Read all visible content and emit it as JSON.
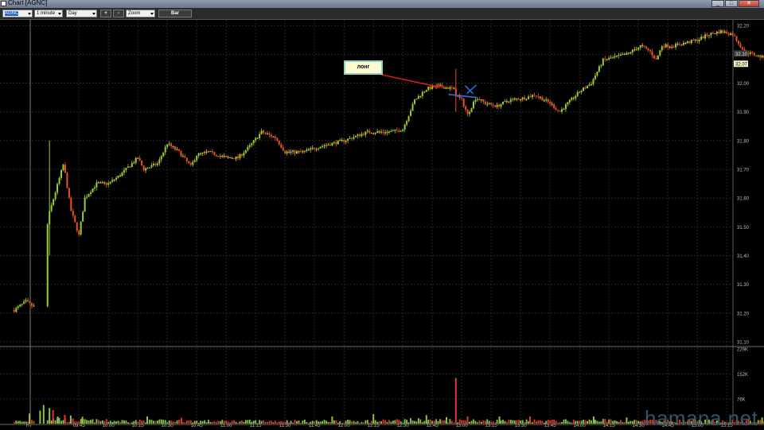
{
  "window": {
    "title": "Chart [AGNC]",
    "btn_min": "_",
    "btn_max": "□",
    "btn_close": "✕"
  },
  "toolbar": {
    "symbol": "AGNC",
    "interval": "1 minute",
    "range": "Day",
    "zoom_in": "+",
    "zoom_out": "-",
    "zoom": "Zoom",
    "bar": "Bar"
  },
  "annotation": {
    "label": "лонг"
  },
  "watermark": "hamana.net",
  "colors": {
    "up": "#9acd32",
    "down": "#e8531f",
    "doji": "#f2c12e",
    "grid": "#252525",
    "arrow": "#e0201a",
    "cross": "#2f6fd9",
    "volume_up": "#8cc63f",
    "volume_down": "#d93d2a"
  },
  "chart_data": {
    "type": "candlestick",
    "y_axis": {
      "ticks": [
        "32.20",
        "32.10",
        "32.00",
        "31.90",
        "31.80",
        "31.70",
        "31.60",
        "31.50",
        "31.40",
        "31.30",
        "31.20",
        "31.10"
      ],
      "ylim": [
        31.1,
        32.22
      ]
    },
    "x_axis": {
      "ticks": [
        "Fri",
        "09:45",
        "10:00",
        "10:15",
        "10:30",
        "10:45",
        "11:00",
        "11:15",
        "11:30",
        "11:45",
        "12:00",
        "12:15",
        "12:30",
        "12:45",
        "13:00",
        "13:15",
        "13:30",
        "13:45",
        "14:00",
        "14:15",
        "14:30",
        "14:45",
        "15:00",
        "15:15"
      ]
    },
    "last_price_tags": [
      "32.10",
      "32.07"
    ],
    "volume_axis": {
      "ticks": [
        "229K",
        "152K",
        "76K"
      ],
      "ylim": [
        0,
        229
      ]
    },
    "price_path": [
      [
        9.2,
        31.21
      ],
      [
        9.3,
        31.24
      ],
      [
        9.37,
        31.22
      ],
      [
        9.5,
        31.55
      ],
      [
        9.62,
        31.72
      ],
      [
        9.68,
        31.56
      ],
      [
        9.75,
        31.47
      ],
      [
        9.8,
        31.6
      ],
      [
        9.9,
        31.65
      ],
      [
        10.0,
        31.65
      ],
      [
        10.1,
        31.68
      ],
      [
        10.25,
        31.74
      ],
      [
        10.3,
        31.7
      ],
      [
        10.42,
        31.72
      ],
      [
        10.5,
        31.79
      ],
      [
        10.6,
        31.76
      ],
      [
        10.7,
        31.71
      ],
      [
        10.75,
        31.75
      ],
      [
        10.85,
        31.76
      ],
      [
        11.0,
        31.74
      ],
      [
        11.1,
        31.74
      ],
      [
        11.2,
        31.78
      ],
      [
        11.3,
        31.83
      ],
      [
        11.42,
        31.81
      ],
      [
        11.5,
        31.76
      ],
      [
        11.65,
        31.76
      ],
      [
        11.8,
        31.78
      ],
      [
        12.0,
        31.8
      ],
      [
        12.2,
        31.83
      ],
      [
        12.4,
        31.83
      ],
      [
        12.5,
        31.84
      ],
      [
        12.6,
        31.94
      ],
      [
        12.7,
        31.98
      ],
      [
        12.8,
        31.99
      ],
      [
        12.93,
        31.98
      ],
      [
        12.95,
        31.96
      ],
      [
        13.0,
        31.94
      ],
      [
        13.05,
        31.89
      ],
      [
        13.12,
        31.95
      ],
      [
        13.2,
        31.93
      ],
      [
        13.3,
        31.92
      ],
      [
        13.4,
        31.94
      ],
      [
        13.55,
        31.95
      ],
      [
        13.62,
        31.96
      ],
      [
        13.75,
        31.93
      ],
      [
        13.83,
        31.9
      ],
      [
        13.95,
        31.95
      ],
      [
        14.0,
        31.97
      ],
      [
        14.1,
        32.0
      ],
      [
        14.2,
        32.08
      ],
      [
        14.3,
        32.09
      ],
      [
        14.4,
        32.1
      ],
      [
        14.52,
        32.13
      ],
      [
        14.6,
        32.11
      ],
      [
        14.65,
        32.08
      ],
      [
        14.7,
        32.13
      ],
      [
        14.8,
        32.13
      ],
      [
        14.9,
        32.14
      ],
      [
        15.0,
        32.15
      ],
      [
        15.1,
        32.17
      ],
      [
        15.2,
        32.18
      ],
      [
        15.3,
        32.17
      ],
      [
        15.4,
        32.11
      ],
      [
        15.55,
        32.09
      ],
      [
        15.6,
        32.1
      ],
      [
        15.65,
        32.07
      ]
    ],
    "volume_profile": [
      [
        9.2,
        12
      ],
      [
        9.3,
        10
      ],
      [
        9.4,
        25
      ],
      [
        9.5,
        30
      ],
      [
        9.65,
        18
      ],
      [
        9.8,
        15
      ],
      [
        10.0,
        14
      ],
      [
        10.5,
        13
      ],
      [
        11.0,
        12
      ],
      [
        11.5,
        13
      ],
      [
        12.0,
        12
      ],
      [
        12.4,
        14
      ],
      [
        12.6,
        18
      ],
      [
        12.8,
        16
      ],
      [
        13.0,
        16
      ],
      [
        13.2,
        14
      ],
      [
        13.5,
        13
      ],
      [
        14.0,
        14
      ],
      [
        14.2,
        16
      ],
      [
        14.5,
        13
      ],
      [
        15.0,
        13
      ],
      [
        15.65,
        12
      ]
    ],
    "volume_spikes": [
      {
        "t": 9.33,
        "k": 31,
        "dir": "up"
      },
      {
        "t": 9.42,
        "k": 40,
        "dir": "up"
      },
      {
        "t": 9.45,
        "k": 57,
        "dir": "up"
      },
      {
        "t": 9.5,
        "k": 48,
        "dir": "up"
      },
      {
        "t": 9.53,
        "k": 42,
        "dir": "down"
      },
      {
        "t": 9.57,
        "k": 22,
        "dir": "up"
      },
      {
        "t": 9.63,
        "k": 27,
        "dir": "down"
      },
      {
        "t": 9.68,
        "k": 25,
        "dir": "up"
      },
      {
        "t": 9.78,
        "k": 21,
        "dir": "up"
      },
      {
        "t": 10.33,
        "k": 22,
        "dir": "up"
      },
      {
        "t": 10.62,
        "k": 18,
        "dir": "down"
      },
      {
        "t": 11.9,
        "k": 22,
        "dir": "up"
      },
      {
        "t": 12.25,
        "k": 29,
        "dir": "up"
      },
      {
        "t": 12.7,
        "k": 26,
        "dir": "up"
      },
      {
        "t": 12.87,
        "k": 20,
        "dir": "up"
      },
      {
        "t": 12.95,
        "k": 140,
        "dir": "down"
      },
      {
        "t": 13.05,
        "k": 22,
        "dir": "down"
      },
      {
        "t": 13.32,
        "k": 22,
        "dir": "up"
      },
      {
        "t": 13.58,
        "k": 22,
        "dir": "down"
      },
      {
        "t": 14.12,
        "k": 22,
        "dir": "up"
      },
      {
        "t": 14.4,
        "k": 19,
        "dir": "up"
      },
      {
        "t": 15.55,
        "k": 19,
        "dir": "up"
      }
    ]
  }
}
